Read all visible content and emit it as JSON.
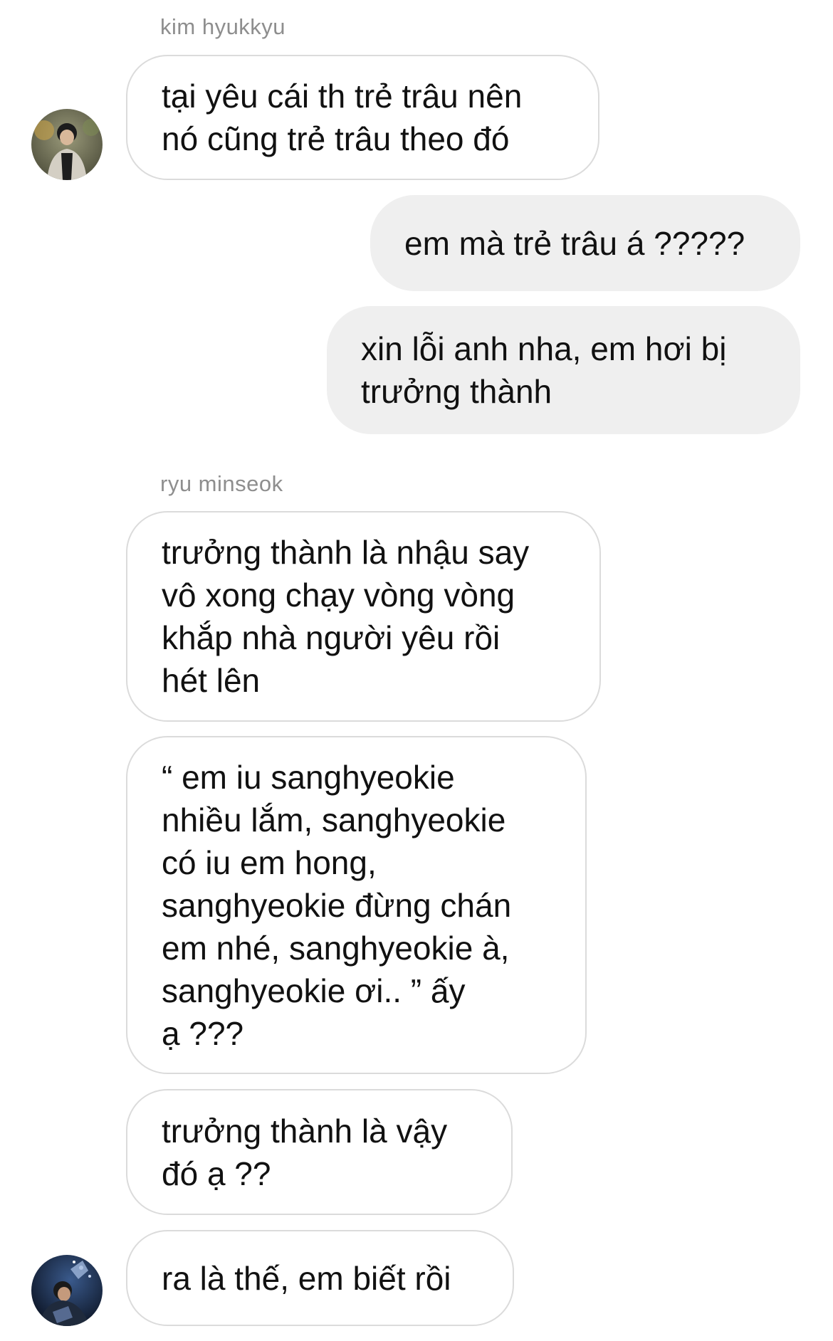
{
  "thread": {
    "messages": [
      {
        "sender": "kim hyukkyu",
        "text": "tại yêu cái th trẻ trâu nên\nnó cũng trẻ trâu theo đó"
      },
      {
        "sender": "me",
        "text": "em mà trẻ trâu á ?????"
      },
      {
        "sender": "me",
        "text": "xin lỗi anh nha, em hơi bị\ntrưởng thành"
      },
      {
        "sender": "ryu minseok",
        "text": "trưởng thành là nhậu say\nvô xong chạy vòng vòng\nkhắp nhà người yêu rồi\nhét lên"
      },
      {
        "sender": "ryu minseok",
        "text": "“ em iu sanghyeokie\nnhiều lắm, sanghyeokie\ncó iu em hong,\nsanghyeokie đừng chán\nem nhé, sanghyeokie à,\nsanghyeokie ơi.. ” ấy\nạ ???"
      },
      {
        "sender": "ryu minseok",
        "text": "trưởng thành là vậy\nđó ạ ??"
      },
      {
        "sender": "ryu minseok",
        "text": "ra là thế, em biết rồi"
      }
    ]
  },
  "senders": {
    "first": "kim hyukkyu",
    "second": "ryu minseok"
  },
  "avatars": {
    "first_icon": "profile-photo-icon",
    "second_icon": "profile-photo-icon"
  },
  "colors": {
    "incoming_bg": "#ffffff",
    "incoming_border": "#dbdbdb",
    "outgoing_bg": "#efefef",
    "sender_name": "#8e8e8e",
    "text": "#111111"
  }
}
